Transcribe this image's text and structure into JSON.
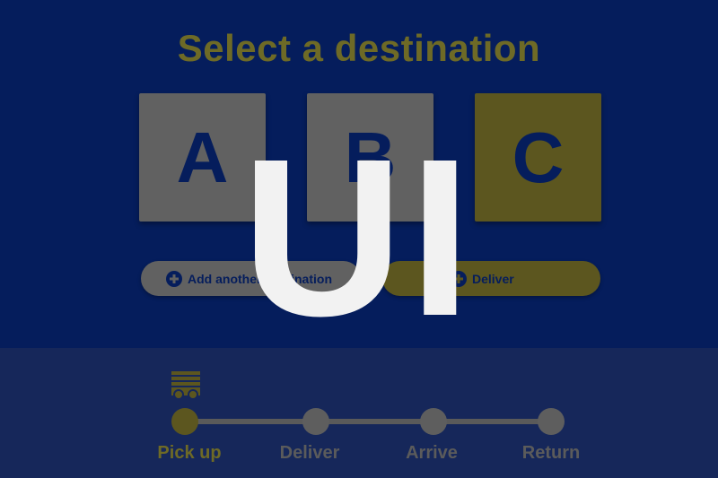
{
  "title": "Select a destination",
  "destinations": [
    {
      "label": "A",
      "selected": false
    },
    {
      "label": "B",
      "selected": false
    },
    {
      "label": "C",
      "selected": true
    }
  ],
  "actions": {
    "add_label": "Add another destination",
    "deliver_label": "Deliver"
  },
  "steps": [
    {
      "label": "Pick up",
      "active": true
    },
    {
      "label": "Deliver",
      "active": false
    },
    {
      "label": "Arrive",
      "active": false
    },
    {
      "label": "Return",
      "active": false
    }
  ],
  "overlay": {
    "text": "UI"
  },
  "icons": {
    "cart": "cart-icon",
    "plus": "plus-icon"
  },
  "colors": {
    "background": "#051d5c",
    "footer": "#16275a",
    "accent": "#5c561f",
    "inactive": "#616161"
  }
}
